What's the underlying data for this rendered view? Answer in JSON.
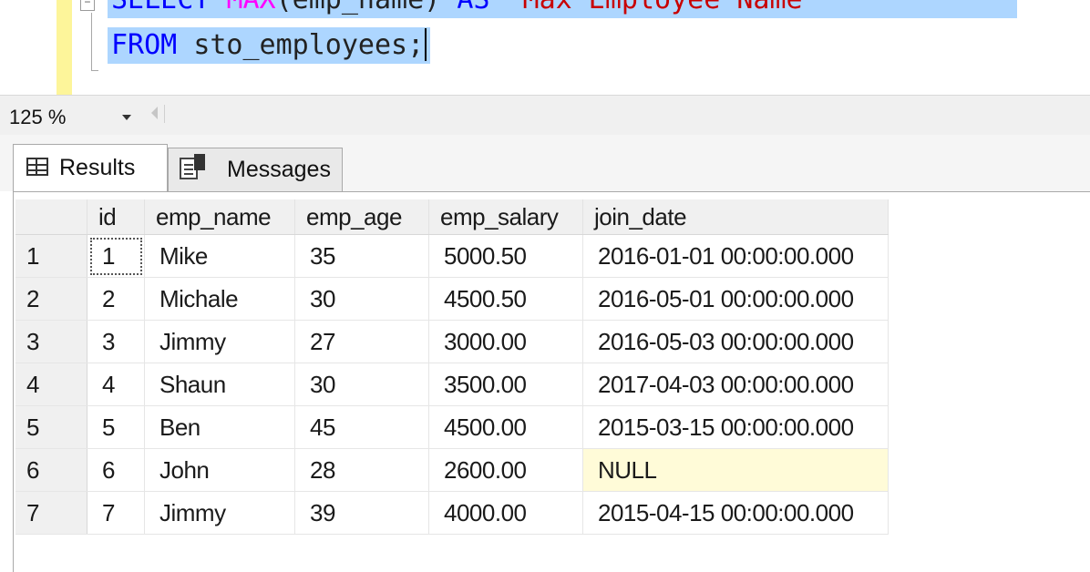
{
  "editor": {
    "line1": {
      "kw_select": "SELECT",
      "fn_max": "MAX",
      "args": "(emp_name)",
      "kw_as": "AS",
      "alias": "'Max Employee Name'"
    },
    "line2": {
      "kw_from": "FROM",
      "table": "sto_employees;"
    },
    "collapse_glyph": "−",
    "colors": {
      "keyword": "#0000ff",
      "function": "#ff00ff",
      "string": "#c80000",
      "selection": "#add6ff"
    }
  },
  "zoom": {
    "value": "125 %"
  },
  "tabs": {
    "results": "Results",
    "messages": "Messages"
  },
  "grid": {
    "columns": [
      "",
      "id",
      "emp_name",
      "emp_age",
      "emp_salary",
      "join_date"
    ],
    "rows": [
      {
        "n": "1",
        "id": "1",
        "emp_name": "Mike",
        "emp_age": "35",
        "emp_salary": "5000.50",
        "join_date": "2016-01-01 00:00:00.000"
      },
      {
        "n": "2",
        "id": "2",
        "emp_name": "Michale",
        "emp_age": "30",
        "emp_salary": "4500.50",
        "join_date": "2016-05-01 00:00:00.000"
      },
      {
        "n": "3",
        "id": "3",
        "emp_name": "Jimmy",
        "emp_age": "27",
        "emp_salary": "3000.00",
        "join_date": "2016-05-03 00:00:00.000"
      },
      {
        "n": "4",
        "id": "4",
        "emp_name": "Shaun",
        "emp_age": "30",
        "emp_salary": "3500.00",
        "join_date": "2017-04-03 00:00:00.000"
      },
      {
        "n": "5",
        "id": "5",
        "emp_name": "Ben",
        "emp_age": "45",
        "emp_salary": "4500.00",
        "join_date": "2015-03-15 00:00:00.000"
      },
      {
        "n": "6",
        "id": "6",
        "emp_name": "John",
        "emp_age": "28",
        "emp_salary": "2600.00",
        "join_date": "NULL"
      },
      {
        "n": "7",
        "id": "7",
        "emp_name": "Jimmy",
        "emp_age": "39",
        "emp_salary": "4000.00",
        "join_date": "2015-04-15 00:00:00.000"
      }
    ]
  }
}
